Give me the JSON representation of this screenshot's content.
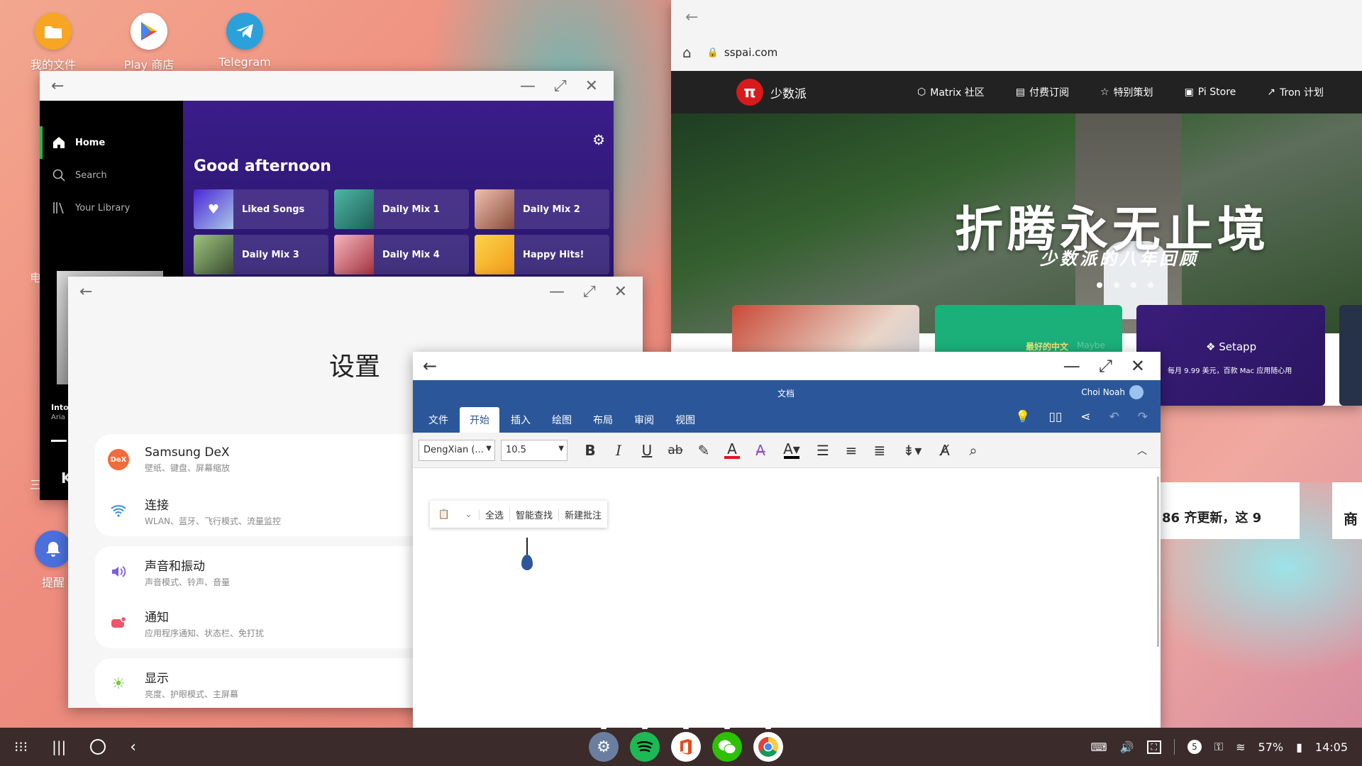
{
  "desktop": {
    "icons": [
      {
        "label": "我的文件",
        "icon": "folder-icon",
        "color": "#f6a623"
      },
      {
        "label": "Play 商店",
        "icon": "play-store-icon",
        "color": "#ffffff"
      },
      {
        "label": "Telegram",
        "icon": "telegram-icon",
        "color": "#2aa1da"
      }
    ],
    "side_icons": [
      {
        "label": "提醒",
        "icon": "reminder-icon",
        "color": "#4b6fdc"
      }
    ],
    "partial_labels": [
      "电",
      "三"
    ]
  },
  "spotify": {
    "nav": [
      {
        "label": "Home",
        "icon": "home-icon"
      },
      {
        "label": "Search",
        "icon": "search-icon"
      },
      {
        "label": "Your Library",
        "icon": "library-icon"
      }
    ],
    "greeting": "Good afternoon",
    "cards": [
      {
        "label": "Liked Songs",
        "color": "#6a4de3"
      },
      {
        "label": "Daily Mix 1",
        "color": "#2f9a8d"
      },
      {
        "label": "Daily Mix 2",
        "color": "#d79785"
      },
      {
        "label": "Daily Mix 3",
        "color": "#597a4f"
      },
      {
        "label": "Daily Mix 4",
        "color": "#e5a0a8"
      },
      {
        "label": "Happy Hits!",
        "color": "#f4c13b"
      }
    ],
    "now_playing": {
      "title": "Into",
      "artist": "Aria"
    }
  },
  "settings": {
    "title": "设置",
    "groups": [
      [
        {
          "title": "Samsung DeX",
          "subtitle": "壁纸、键盘、屏幕缩放",
          "icon": "dex-icon",
          "color": "#f26b3a"
        },
        {
          "title": "连接",
          "subtitle": "WLAN、蓝牙、飞行模式、流量监控",
          "icon": "wifi-icon",
          "color": "#3a8de0"
        }
      ],
      [
        {
          "title": "声音和振动",
          "subtitle": "声音模式、铃声、音量",
          "icon": "volume-icon",
          "color": "#7d5de0"
        },
        {
          "title": "通知",
          "subtitle": "应用程序通知、状态栏、免打扰",
          "icon": "notification-icon",
          "color": "#f0556b"
        }
      ],
      [
        {
          "title": "显示",
          "subtitle": "亮度、护眼模式、主屏幕",
          "icon": "brightness-icon",
          "color": "#7cc843"
        }
      ]
    ]
  },
  "browser": {
    "url": "sspai.com",
    "site": {
      "brand": "少数派",
      "nav": [
        {
          "label": "Matrix 社区",
          "icon": "matrix-icon"
        },
        {
          "label": "付费订阅",
          "icon": "subscription-icon"
        },
        {
          "label": "特别策划",
          "icon": "star-icon"
        },
        {
          "label": "Pi Store",
          "icon": "store-icon"
        },
        {
          "label": "Tron 计划",
          "icon": "tron-icon"
        }
      ],
      "hero_title": "折腾永无止境",
      "hero_subtitle": "少数派的八年回顾",
      "promo_green": "最好的中文",
      "promo_green_faint": "Maybe",
      "promo_setapp_title": "Setapp",
      "promo_setapp_sub": "每月 9.99 美元，百款 Mac 应用随心用",
      "article_snippet": "86 齐更新，这 9",
      "partial_right": "商"
    }
  },
  "word": {
    "doc_title": "文档",
    "user": "Choi Noah",
    "tabs": [
      "文件",
      "开始",
      "插入",
      "绘图",
      "布局",
      "审阅",
      "视图"
    ],
    "active_tab": "开始",
    "font_name": "DengXian (...",
    "font_size": "10.5",
    "context_menu": [
      "全选",
      "智能查找",
      "新建批注"
    ],
    "accent": "#2b579a"
  },
  "taskbar": {
    "apps": [
      {
        "name": "settings-app",
        "color": "#6a7fa0"
      },
      {
        "name": "spotify-app",
        "color": "#1db954"
      },
      {
        "name": "office-app",
        "color": "#ffffff"
      },
      {
        "name": "wechat-app",
        "color": "#2dc100"
      },
      {
        "name": "chrome-app",
        "color": "#ffffff"
      }
    ],
    "notif_count": "5",
    "battery": "57%",
    "time": "14:05"
  }
}
